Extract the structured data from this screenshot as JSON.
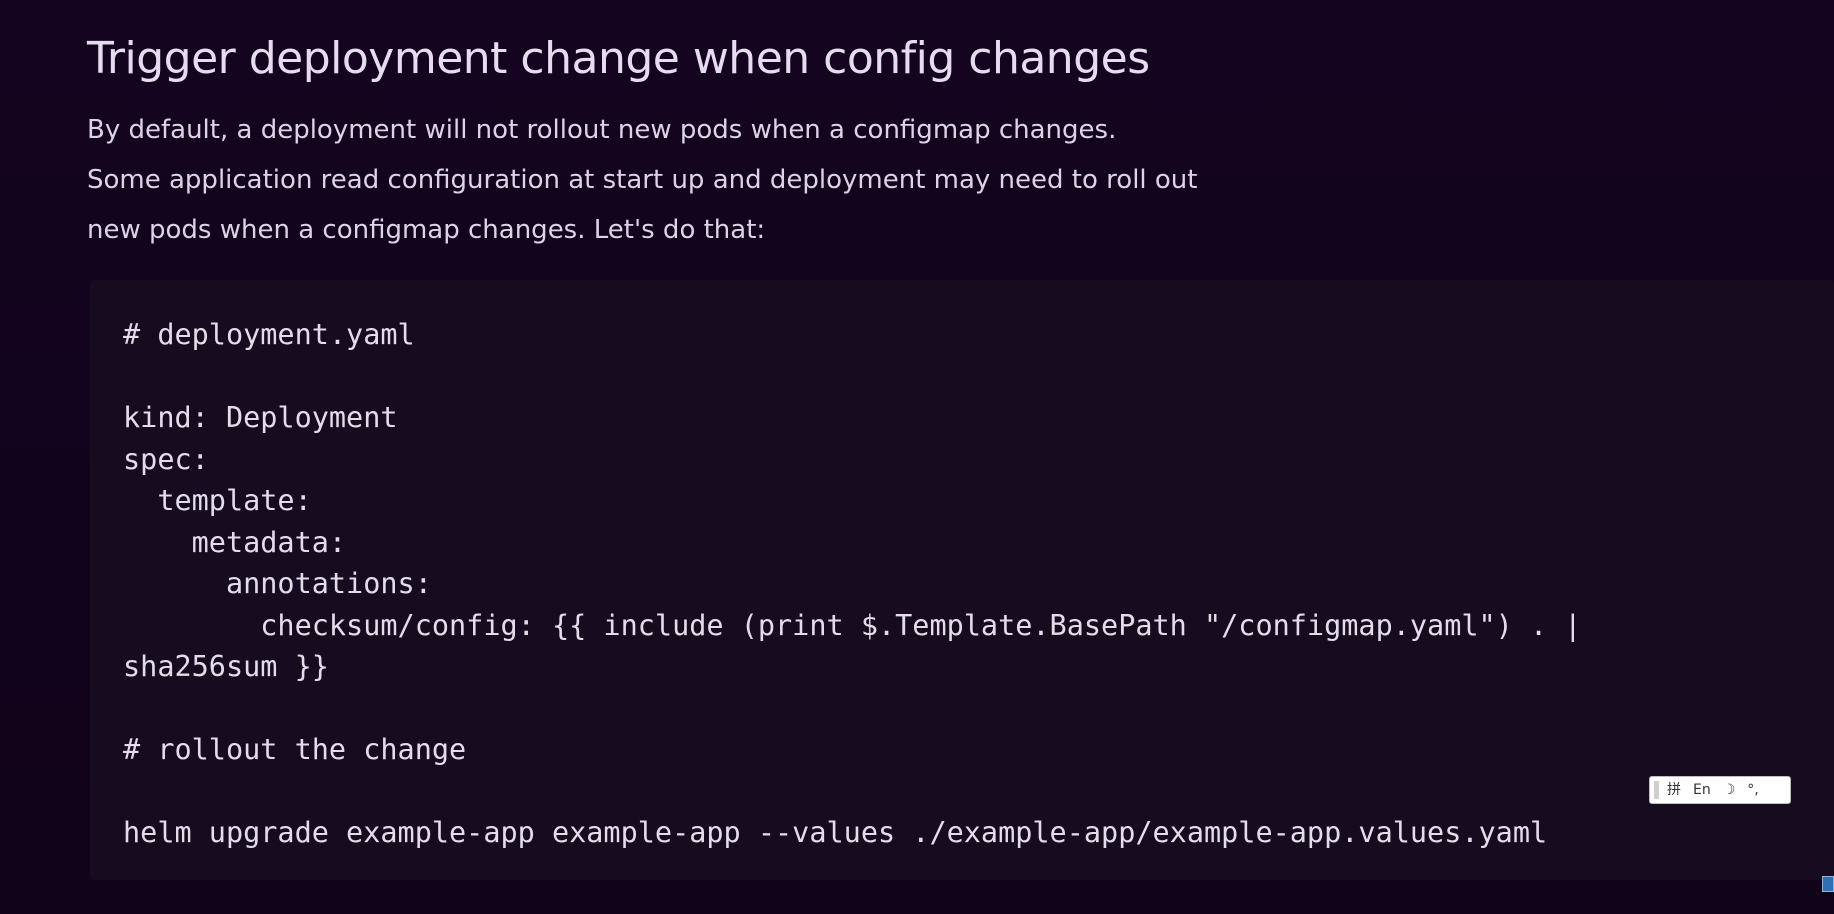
{
  "section": {
    "title": "Trigger deployment change when config changes",
    "intro_lines": [
      "By default, a deployment will not rollout new pods when a configmap changes.",
      "Some application read configuration at start up and deployment may need to roll out",
      "new pods when a configmap changes. Let's do that:"
    ]
  },
  "code": {
    "lines": [
      "# deployment.yaml",
      "",
      "kind: Deployment",
      "spec:",
      "  template:",
      "    metadata:",
      "      annotations:",
      "        checksum/config: {{ include (print $.Template.BasePath \"/configmap.yaml\") . |",
      "sha256sum }}",
      "",
      "# rollout the change",
      "",
      "helm upgrade example-app example-app --values ./example-app/example-app.values.yaml"
    ]
  },
  "ime_toolbar": {
    "mode_label": "拼",
    "lang_label": "En",
    "moon_glyph": "☽",
    "punct_glyph": "°,"
  },
  "colors": {
    "background": "#12031e",
    "code_background": "#170b1f",
    "text": "#ddd4e8"
  }
}
